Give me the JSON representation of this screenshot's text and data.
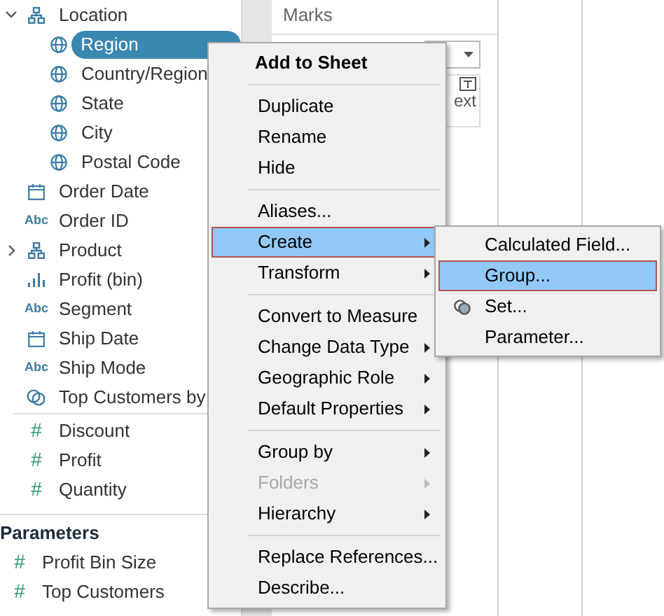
{
  "data_pane": {
    "fields": [
      {
        "label": "Location",
        "kind": "hierarchy",
        "expanded": true,
        "children": [
          {
            "label": "Region",
            "kind": "geo",
            "selected": true
          },
          {
            "label": "Country/Region",
            "kind": "geo",
            "selected": false
          },
          {
            "label": "State",
            "kind": "geo",
            "selected": false
          },
          {
            "label": "City",
            "kind": "geo",
            "selected": false
          },
          {
            "label": "Postal Code",
            "kind": "geo",
            "selected": false
          }
        ]
      },
      {
        "label": "Order Date",
        "kind": "date"
      },
      {
        "label": "Order ID",
        "kind": "string",
        "glyph": "Abc"
      },
      {
        "label": "Product",
        "kind": "hierarchy",
        "expanded": false
      },
      {
        "label": "Profit (bin)",
        "kind": "bin"
      },
      {
        "label": "Segment",
        "kind": "string",
        "glyph": "Abc"
      },
      {
        "label": "Ship Date",
        "kind": "date"
      },
      {
        "label": "Ship Mode",
        "kind": "string",
        "glyph": "Abc"
      },
      {
        "label": "Top Customers by",
        "kind": "set"
      }
    ],
    "measures": [
      {
        "label": "Discount",
        "glyph": "#"
      },
      {
        "label": "Profit",
        "glyph": "#"
      },
      {
        "label": "Quantity",
        "glyph": "#"
      }
    ],
    "parameters": {
      "title": "Parameters",
      "items": [
        {
          "label": "Profit Bin Size",
          "glyph": "#"
        },
        {
          "label": "Top Customers",
          "glyph": "#"
        }
      ]
    }
  },
  "marks": {
    "title": "Marks",
    "text_button": "ext"
  },
  "context_menu": [
    {
      "kind": "header",
      "label": "Add to Sheet"
    },
    {
      "kind": "separator"
    },
    {
      "kind": "item",
      "label": "Duplicate",
      "submenu": false,
      "disabled": false,
      "selected": false
    },
    {
      "kind": "item",
      "label": "Rename",
      "submenu": false,
      "disabled": false,
      "selected": false
    },
    {
      "kind": "item",
      "label": "Hide",
      "submenu": false,
      "disabled": false,
      "selected": false
    },
    {
      "kind": "separator"
    },
    {
      "kind": "item",
      "label": "Aliases...",
      "submenu": false,
      "disabled": false,
      "selected": false
    },
    {
      "kind": "item",
      "label": "Create",
      "submenu": true,
      "disabled": false,
      "selected": true
    },
    {
      "kind": "item",
      "label": "Transform",
      "submenu": true,
      "disabled": false,
      "selected": false
    },
    {
      "kind": "separator"
    },
    {
      "kind": "item",
      "label": "Convert to Measure",
      "submenu": false,
      "disabled": false,
      "selected": false
    },
    {
      "kind": "item",
      "label": "Change Data Type",
      "submenu": true,
      "disabled": false,
      "selected": false
    },
    {
      "kind": "item",
      "label": "Geographic Role",
      "submenu": true,
      "disabled": false,
      "selected": false
    },
    {
      "kind": "item",
      "label": "Default Properties",
      "submenu": true,
      "disabled": false,
      "selected": false
    },
    {
      "kind": "separator"
    },
    {
      "kind": "item",
      "label": "Group by",
      "submenu": true,
      "disabled": false,
      "selected": false
    },
    {
      "kind": "item",
      "label": "Folders",
      "submenu": true,
      "disabled": true,
      "selected": false
    },
    {
      "kind": "item",
      "label": "Hierarchy",
      "submenu": true,
      "disabled": false,
      "selected": false
    },
    {
      "kind": "separator"
    },
    {
      "kind": "item",
      "label": "Replace References...",
      "submenu": false,
      "disabled": false,
      "selected": false
    },
    {
      "kind": "item",
      "label": "Describe...",
      "submenu": false,
      "disabled": false,
      "selected": false
    }
  ],
  "create_submenu": [
    {
      "label": "Calculated Field...",
      "kind": "plain",
      "selected": false
    },
    {
      "label": "Group...",
      "kind": "plain",
      "selected": true
    },
    {
      "label": "Set...",
      "kind": "set",
      "selected": false
    },
    {
      "label": "Parameter...",
      "kind": "plain",
      "selected": false
    }
  ]
}
